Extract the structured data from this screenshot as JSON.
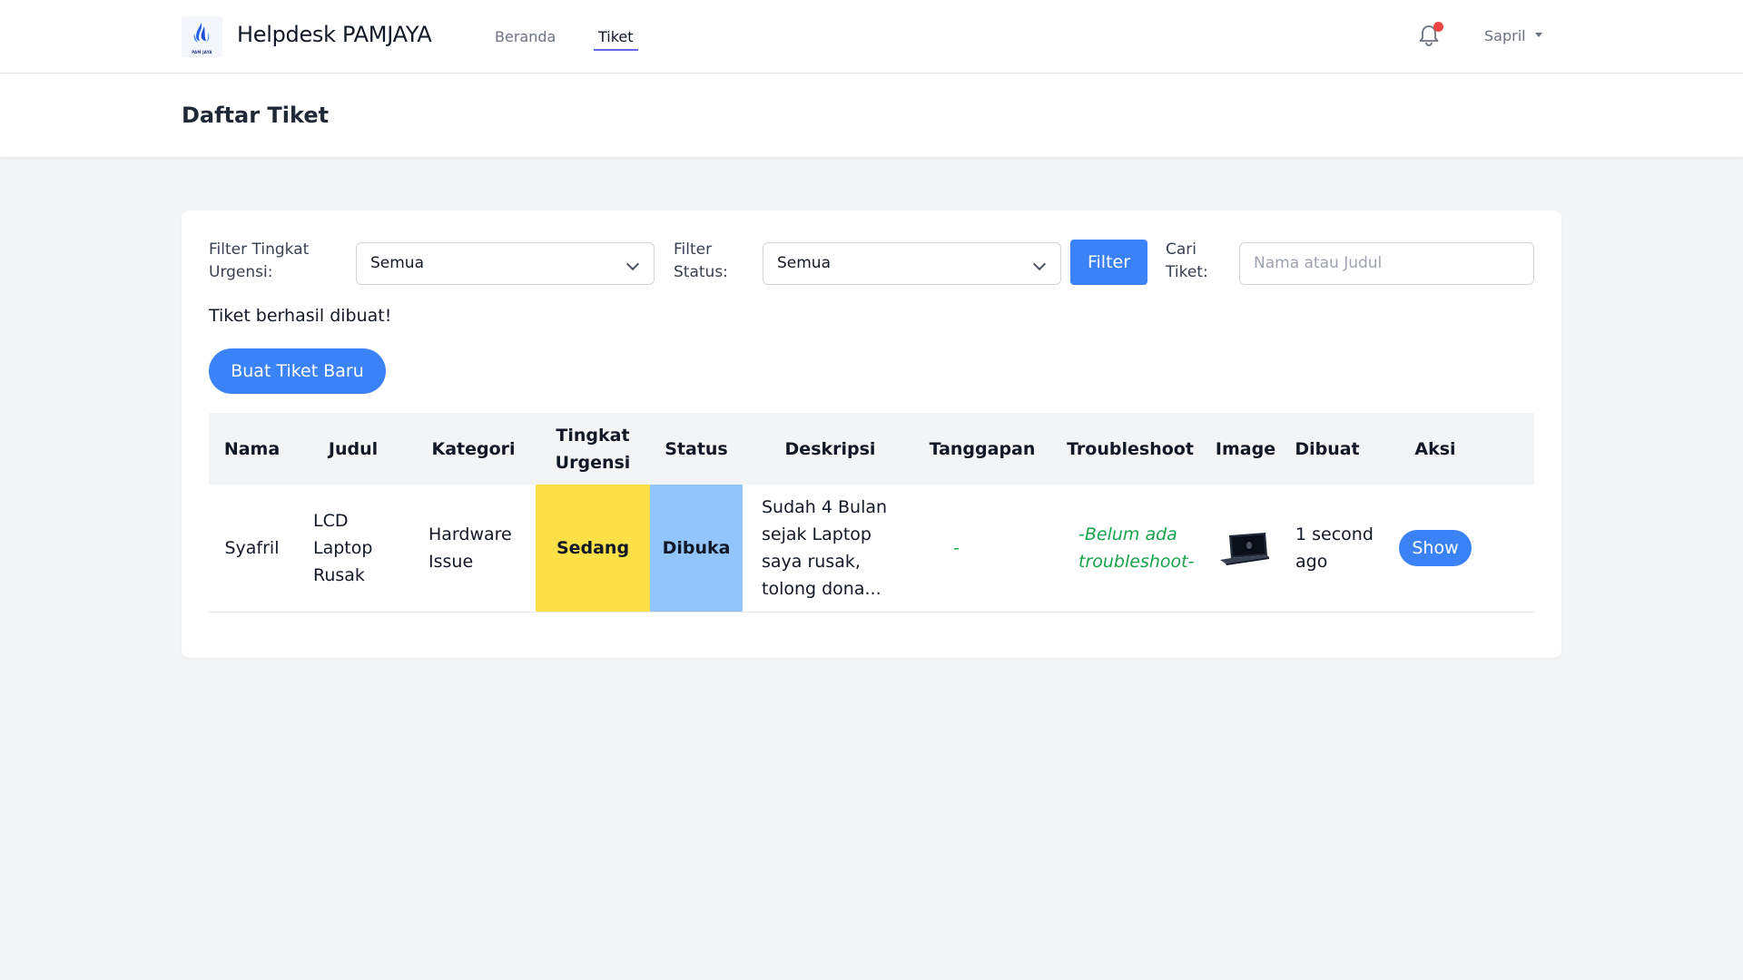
{
  "navbar": {
    "brand": "Helpdesk PAMJAYA",
    "logo_text": "PAM JAYA",
    "links": [
      "Beranda",
      "Tiket"
    ],
    "active_link": "Tiket",
    "user_name": "Sapril",
    "notification_dot_color": "#ef4444"
  },
  "header": {
    "title": "Daftar Tiket"
  },
  "filters": {
    "urgency_label": "Filter Tingkat Urgensi:",
    "urgency_value": "Semua",
    "status_label": "Filter Status:",
    "status_value": "Semua",
    "filter_button": "Filter",
    "search_label": "Cari Tiket:",
    "search_placeholder": "Nama atau Judul"
  },
  "success_message": "Tiket berhasil dibuat!",
  "create_button": "Buat Tiket Baru",
  "table": {
    "columns": [
      "Nama",
      "Judul",
      "Kategori",
      "Tingkat Urgensi",
      "Status",
      "Deskripsi",
      "Tanggapan",
      "Troubleshoot",
      "Image",
      "Dibuat",
      "Aksi"
    ],
    "rows": [
      {
        "nama": "Syafril",
        "judul": "LCD Laptop Rusak",
        "kategori": "Hardware Issue",
        "urgensi": "Sedang",
        "status": "Dibuka",
        "deskripsi": "Sudah 4 Bulan sejak Laptop saya rusak, tolong dona...",
        "tanggapan": "-",
        "troubleshoot": "-Belum ada troubleshoot-",
        "image": "laptop-thumbnail",
        "dibuat": "1 second ago",
        "aksi": "Show"
      }
    ]
  },
  "colors": {
    "accent": "#3b82f6",
    "urgency_medium": "#fde047",
    "status_open": "#93c5fd",
    "troubleshoot_text": "#16a34a"
  }
}
